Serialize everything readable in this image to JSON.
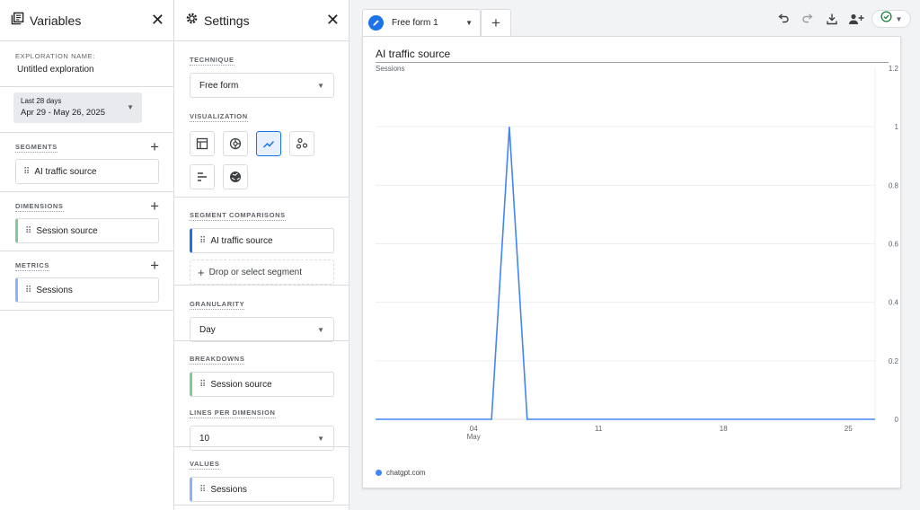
{
  "variables": {
    "title": "Variables",
    "exploration_label": "EXPLORATION NAME:",
    "exploration_name": "Untitled exploration",
    "date_range_label": "Last 28 days",
    "date_range": "Apr 29 - May 26, 2025",
    "segments_label": "SEGMENTS",
    "segments": [
      "AI traffic source"
    ],
    "dimensions_label": "DIMENSIONS",
    "dimensions": [
      "Session source"
    ],
    "metrics_label": "METRICS",
    "metrics": [
      "Sessions"
    ]
  },
  "settings": {
    "title": "Settings",
    "technique_label": "TECHNIQUE",
    "technique": "Free form",
    "visualization_label": "VISUALIZATION",
    "visualization_icons": [
      "table-icon",
      "donut-chart-icon",
      "line-chart-icon",
      "scatter-plot-icon",
      "bar-chart-icon",
      "globe-icon"
    ],
    "visualization_selected": "line-chart-icon",
    "segment_comparisons_label": "SEGMENT COMPARISONS",
    "segment_comparison": "AI traffic source",
    "drop_segment": "Drop or select segment",
    "granularity_label": "GRANULARITY",
    "granularity": "Day",
    "breakdowns_label": "BREAKDOWNS",
    "breakdown": "Session source",
    "lines_per_dimension_label": "LINES PER DIMENSION",
    "lines_per_dimension": "10",
    "values_label": "VALUES",
    "value": "Sessions"
  },
  "tabs": {
    "active": "Free form 1",
    "add_icon": "plus-icon"
  },
  "toolbar": [
    "undo-icon",
    "redo-icon",
    "download-icon",
    "share-user-icon",
    "check-circle-icon"
  ],
  "colors": {
    "accent": "#1a73e8",
    "line": "#4285f4",
    "green": "#188038"
  },
  "chart_data": {
    "type": "line",
    "title": "AI traffic source",
    "ylabel": "Sessions",
    "ylim": [
      0,
      1.2
    ],
    "yticks": [
      0,
      0.2,
      0.4,
      0.6,
      0.8,
      1,
      1.2
    ],
    "yticks_display": [
      "0",
      "0.2",
      "0.4",
      "0.6",
      "0.8",
      "1",
      "1.2"
    ],
    "x": [
      "2025-04-29",
      "2025-04-30",
      "2025-05-01",
      "2025-05-02",
      "2025-05-03",
      "2025-05-04",
      "2025-05-05",
      "2025-05-06",
      "2025-05-07",
      "2025-05-08",
      "2025-05-09",
      "2025-05-10",
      "2025-05-11",
      "2025-05-12",
      "2025-05-13",
      "2025-05-14",
      "2025-05-15",
      "2025-05-16",
      "2025-05-17",
      "2025-05-18",
      "2025-05-19",
      "2025-05-20",
      "2025-05-21",
      "2025-05-22",
      "2025-05-23",
      "2025-05-24",
      "2025-05-25",
      "2025-05-26"
    ],
    "xtick_labels": [
      {
        "date": "2025-05-04",
        "label": "04",
        "sublabel": "May"
      },
      {
        "date": "2025-05-11",
        "label": "11",
        "sublabel": ""
      },
      {
        "date": "2025-05-18",
        "label": "18",
        "sublabel": ""
      },
      {
        "date": "2025-05-25",
        "label": "25",
        "sublabel": ""
      }
    ],
    "series": [
      {
        "name": "chatgpt.com",
        "values": [
          0,
          0,
          0,
          0,
          0,
          0,
          0,
          1,
          0,
          0,
          0,
          0,
          0,
          0,
          0,
          0,
          0,
          0,
          0,
          0,
          0,
          0,
          0,
          0,
          0,
          0,
          0,
          0
        ]
      }
    ],
    "grid": true,
    "legend": "bottom-left"
  }
}
